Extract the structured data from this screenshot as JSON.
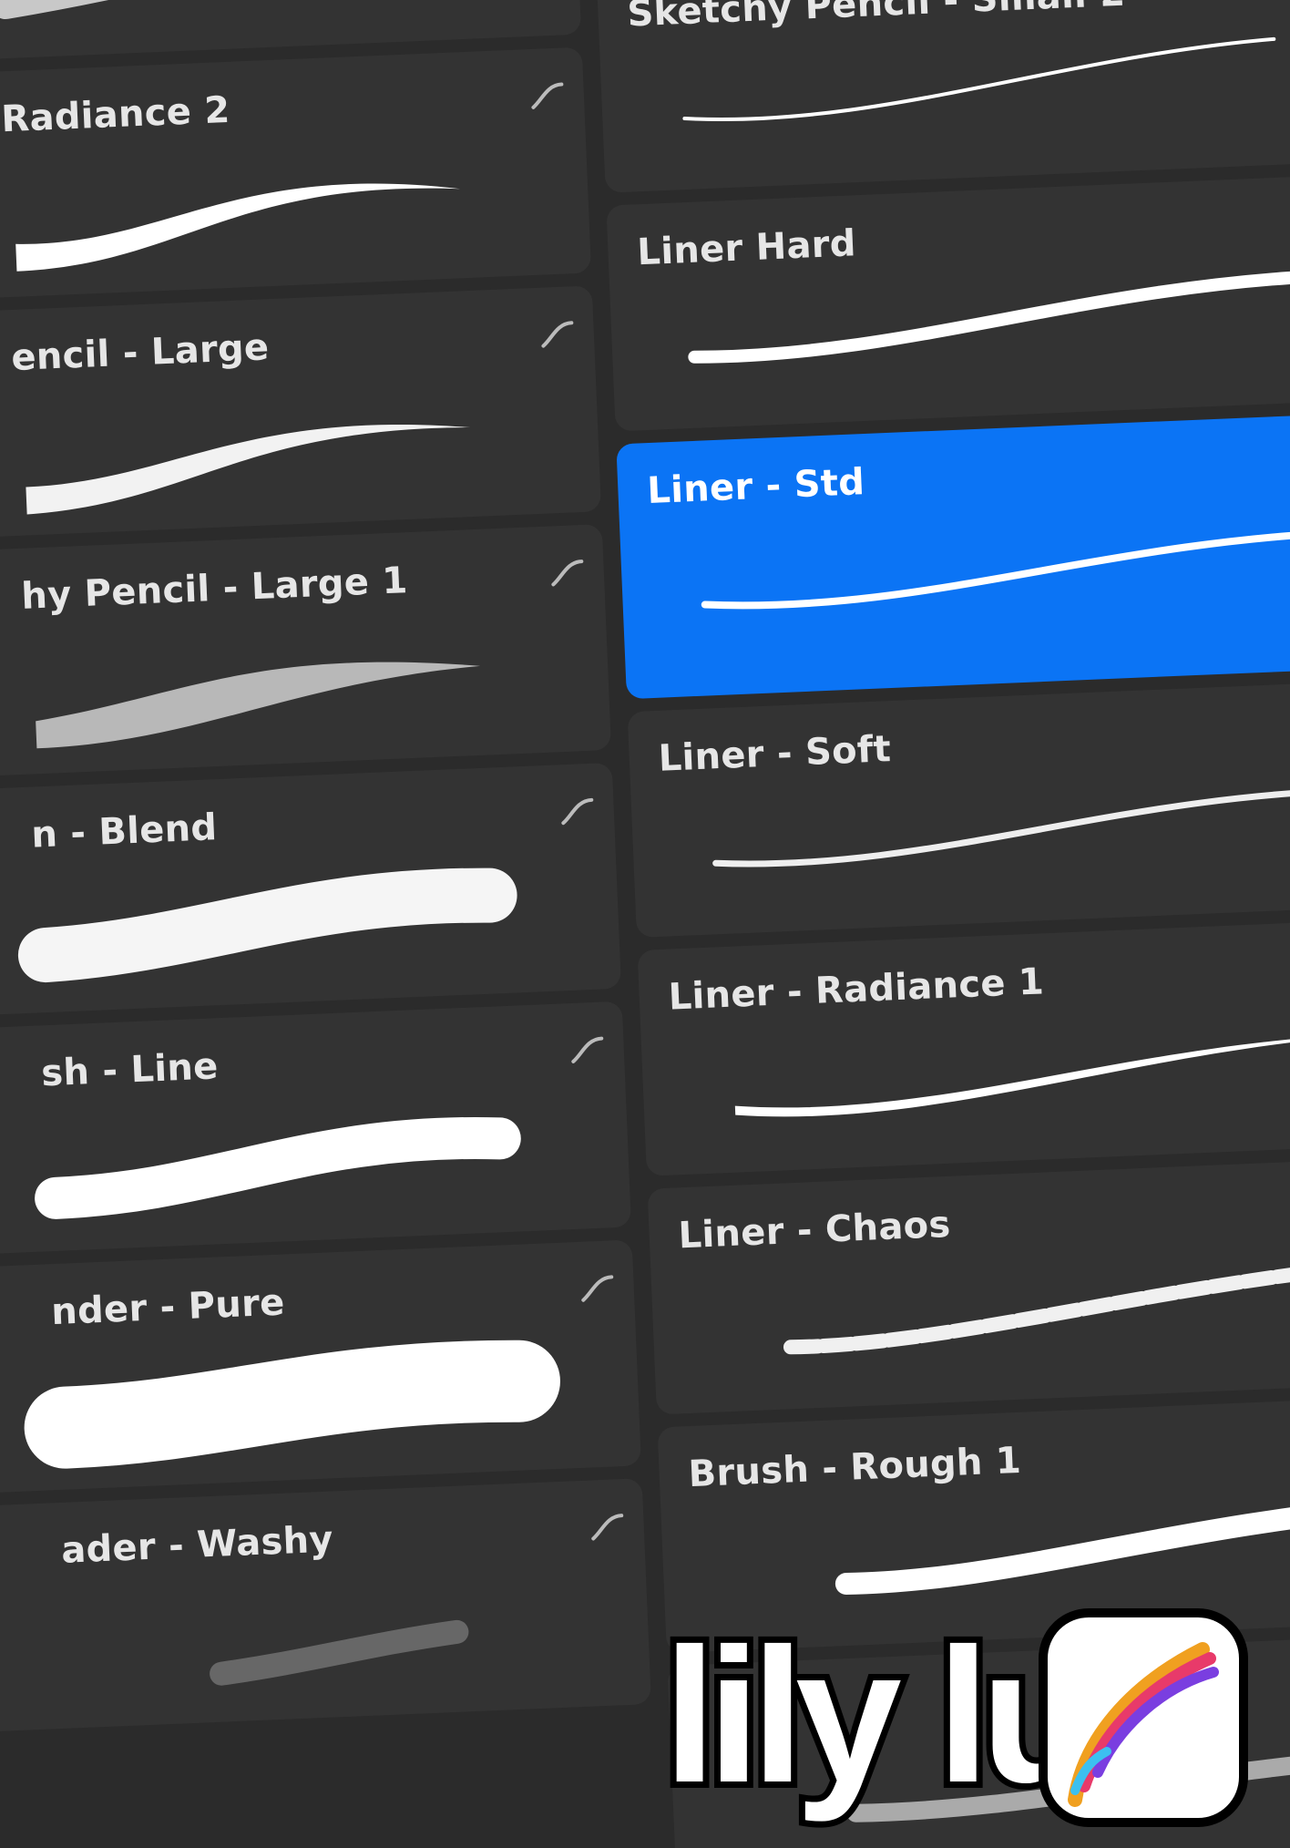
{
  "left_column": {
    "items": [
      {
        "label": ""
      },
      {
        "label": "Radiance 2"
      },
      {
        "label": "encil - Large"
      },
      {
        "label": "hy Pencil - Large 1"
      },
      {
        "label": "n - Blend"
      },
      {
        "label": "sh - Line"
      },
      {
        "label": "nder - Pure"
      },
      {
        "label": "ader - Washy"
      }
    ]
  },
  "right_column": {
    "items": [
      {
        "label": "Sketchy Pencil - Small 2"
      },
      {
        "label": "Liner Hard"
      },
      {
        "label": "Liner - Std",
        "selected": true
      },
      {
        "label": "Liner - Soft"
      },
      {
        "label": "Liner - Radiance 1"
      },
      {
        "label": "Liner - Chaos"
      },
      {
        "label": "Brush - Rough 1"
      },
      {
        "label": ""
      }
    ]
  },
  "logo": {
    "text": "lily lu",
    "icon": "procreate-brush-icon"
  },
  "colors": {
    "background": "#2b2b2b",
    "card": "#333333",
    "selected": "#0b74f5",
    "text": "#e6e6e6"
  }
}
